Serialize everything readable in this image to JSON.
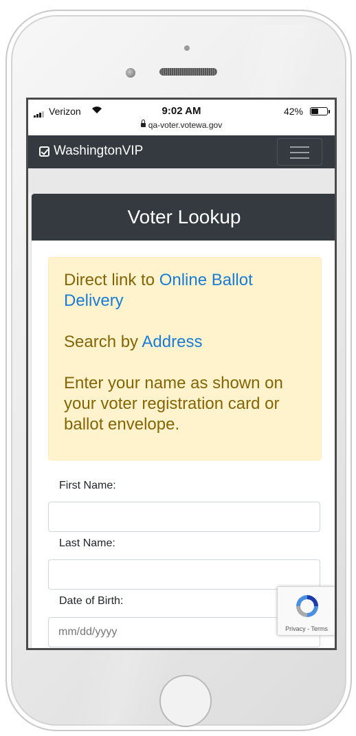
{
  "status_bar": {
    "carrier": "Verizon",
    "time": "9:02 AM",
    "battery": "42%",
    "url": "qa-voter.votewa.gov",
    "icons": [
      "signal-icon",
      "wifi-icon",
      "battery-icon",
      "lock-icon"
    ]
  },
  "navbar": {
    "brand": "WashingtonVIP",
    "brand_icon": "check-square-icon",
    "menu_icon": "hamburger-menu-icon"
  },
  "card": {
    "title": "Voter Lookup"
  },
  "alert": {
    "line1_prefix": "Direct link to ",
    "line1_link": "Online Ballot Delivery",
    "line2_prefix": "Search by ",
    "line2_link": "Address",
    "instructions": "Enter your name as shown on your voter registration card or ballot envelope."
  },
  "form": {
    "first_name_label": "First Name:",
    "first_name_value": "",
    "last_name_label": "Last Name:",
    "last_name_value": "",
    "dob_label": "Date of Birth:",
    "dob_placeholder": "mm/dd/yyyy"
  },
  "recaptcha": {
    "links": "Privacy - Terms",
    "icon": "recaptcha-icon"
  },
  "colors": {
    "navbar_bg": "#343a40",
    "alert_bg": "#fff3cd",
    "alert_text": "#856404",
    "link": "#1a7bd6"
  }
}
